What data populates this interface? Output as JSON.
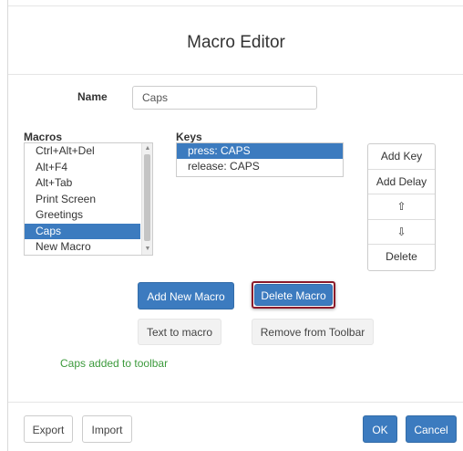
{
  "dialog": {
    "title": "Macro Editor"
  },
  "name_field": {
    "label": "Name",
    "value": "Caps"
  },
  "macros": {
    "label": "Macros",
    "items": [
      "Ctrl+Alt+Del",
      "Alt+F4",
      "Alt+Tab",
      "Print Screen",
      "Greetings",
      "Caps",
      "New Macro"
    ],
    "selected": "Caps"
  },
  "keys": {
    "label": "Keys",
    "items": [
      "press: CAPS",
      "release: CAPS"
    ],
    "selected": "press: CAPS"
  },
  "key_buttons": {
    "add_key": "Add Key",
    "add_delay": "Add Delay",
    "move_up": "⇧",
    "move_down": "⇩",
    "delete": "Delete"
  },
  "actions": {
    "add_new_macro": "Add New Macro",
    "delete_macro": "Delete Macro",
    "text_to_macro": "Text to macro",
    "remove_from_toolbar": "Remove from Toolbar"
  },
  "status_message": "Caps added to toolbar",
  "footer": {
    "export": "Export",
    "import": "Import",
    "ok": "OK",
    "cancel": "Cancel"
  },
  "colors": {
    "primary": "#3c7bbf",
    "status_green": "#3c9a3c",
    "focus_outline": "#8b1a2a"
  }
}
